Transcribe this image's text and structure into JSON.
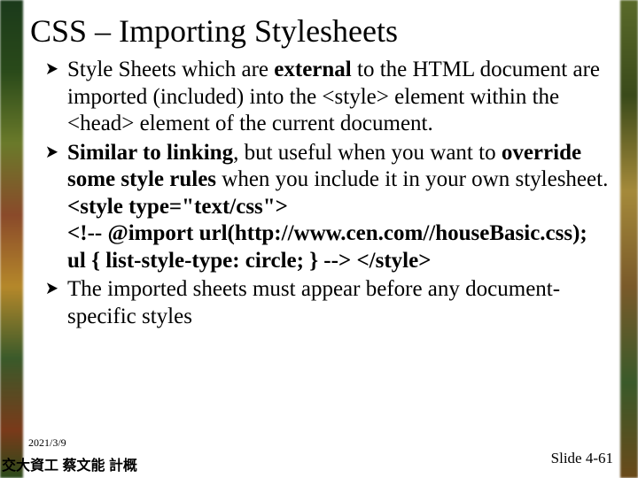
{
  "title": "CSS – Importing Stylesheets",
  "bullets": [
    {
      "parts": [
        {
          "t": "Style Sheets which are ",
          "b": false
        },
        {
          "t": "external",
          "b": true
        },
        {
          "t": " to the HTML document are imported (included) into the <style> element within the <head> element of the current document.",
          "b": false
        }
      ]
    },
    {
      "parts": [
        {
          "t": "Similar to linking",
          "b": true
        },
        {
          "t": ", but useful when you want to ",
          "b": false
        },
        {
          "t": "override some style rules",
          "b": true
        },
        {
          "t": " when you include it in your own stylesheet.",
          "b": false
        },
        {
          "t": "\n<style type=\"text/css\">",
          "b": true
        },
        {
          "t": "\n<!-- @import url(http://www.cen.com//houseBasic.css);",
          "b": true
        },
        {
          "t": "\nul { list-style-type: circle; } -->  </style>",
          "b": true
        }
      ]
    },
    {
      "parts": [
        {
          "t": "The imported sheets must appear before any document-specific styles",
          "b": false
        }
      ]
    }
  ],
  "footer": {
    "date": "2021/3/9",
    "author": "交大資工 蔡文能 計概",
    "slide": "Slide 4-61"
  }
}
